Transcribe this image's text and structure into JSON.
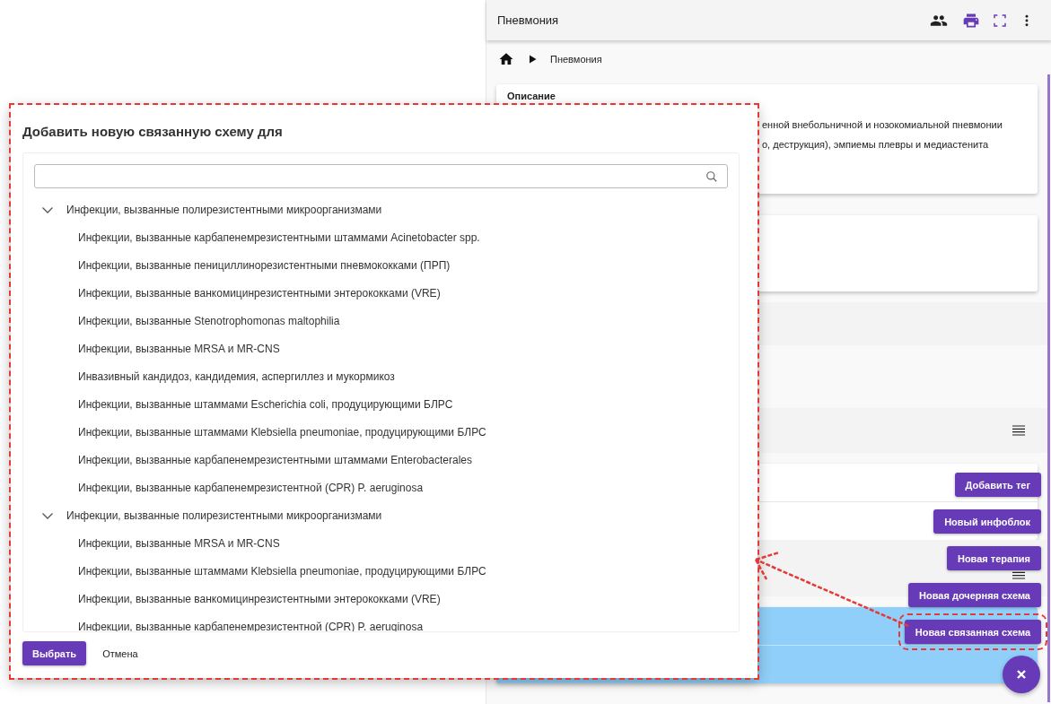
{
  "app_bar": {
    "title": "Пневмония"
  },
  "breadcrumb": {
    "items": [
      "Пневмония"
    ]
  },
  "description_card": {
    "heading": "Описание",
    "lines": [
      "енной внебольничной и нозокомиальной пневмонии",
      "о, деструкция), эмпиемы плевры и медиастенита"
    ]
  },
  "speed_dial": {
    "open": true,
    "actions": [
      {
        "label": "Добавить тег",
        "annotated": false
      },
      {
        "label": "Новый инфоблок",
        "annotated": false
      },
      {
        "label": "Новая терапия",
        "annotated": false
      },
      {
        "label": "Новая дочерняя схема",
        "annotated": false
      },
      {
        "label": "Новая связанная схема",
        "annotated": true
      }
    ]
  },
  "dialog": {
    "title": "Добавить новую связанную схему для",
    "annotated": true,
    "tree": [
      {
        "label": "Инфекции, вызванные полирезистентными микроорганизмами",
        "expanded": true,
        "children": [
          {
            "label": "Инфекции, вызванные карбапенемрезистентными штаммами Acinetobacter spp."
          },
          {
            "label": "Инфекции, вызванные пенициллинорезистентными пневмококками (ПРП)"
          },
          {
            "label": "Инфекции, вызванные ванкомицинрезистентными энтерококками (VRE)"
          },
          {
            "label": "Инфекции, вызванные Stenotrophomonas maltophilia"
          },
          {
            "label": "Инфекции, вызванные MRSA и MR-CNS"
          },
          {
            "label": "Инвазивный кандидоз, кандидемия, аспергиллез и мукормикоз"
          },
          {
            "label": "Инфекции, вызванные штаммами Escherichia coli, продуцирующими БЛРС"
          },
          {
            "label": "Инфекции, вызванные штаммами Klebsiella pneumoniae, продуцирующими БЛРС"
          },
          {
            "label": "Инфекции, вызванные карбапенемрезистентными штаммами Enterobacterales"
          },
          {
            "label": "Инфекции, вызванные карбапенемрезистентной (CPR) P. aeruginosa"
          }
        ]
      },
      {
        "label": "Инфекции, вызванные полирезистентными микроорганизмами",
        "expanded": true,
        "children": [
          {
            "label": "Инфекции, вызванные MRSA и MR-CNS"
          },
          {
            "label": "Инфекции, вызванные штаммами Klebsiella pneumoniae, продуцирующими БЛРС"
          },
          {
            "label": "Инфекции, вызванные ванкомицинрезистентными энтерококками (VRE)"
          },
          {
            "label": "Инфекции, вызванные карбапенемрезистентной (CPR) P. aeruginosa"
          }
        ]
      }
    ],
    "buttons": [
      {
        "label": "Выбрать",
        "kind": "primary"
      },
      {
        "label": "Отмена",
        "kind": "text"
      }
    ]
  }
}
